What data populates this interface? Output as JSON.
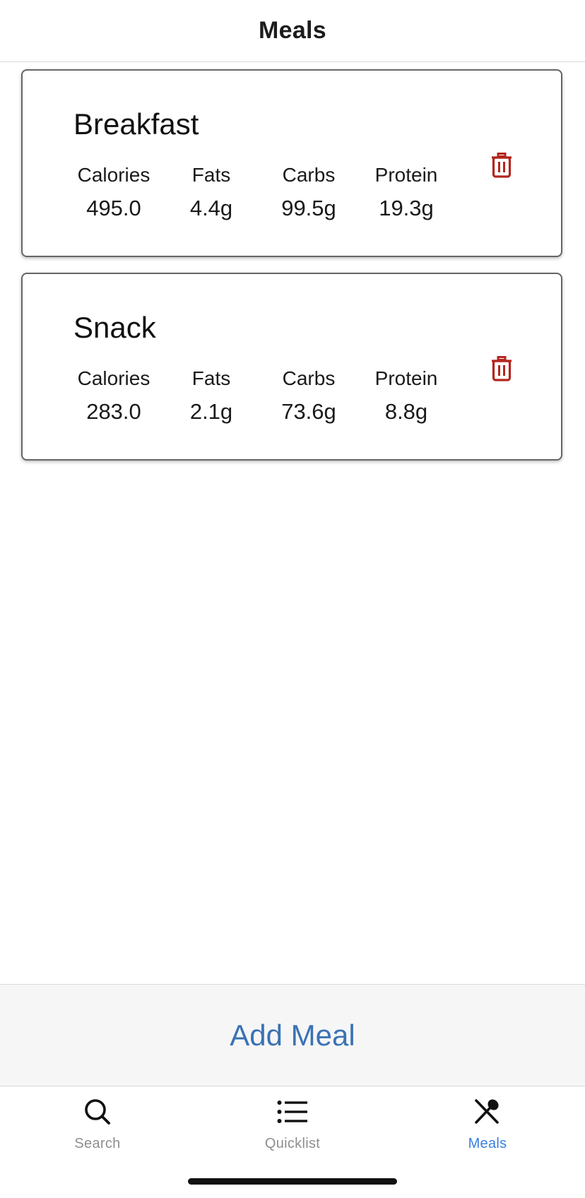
{
  "header": {
    "title": "Meals"
  },
  "stat_labels": {
    "calories": "Calories",
    "fats": "Fats",
    "carbs": "Carbs",
    "protein": "Protein"
  },
  "meals": [
    {
      "name": "Breakfast",
      "calories": "495.0",
      "fats": "4.4g",
      "carbs": "99.5g",
      "protein": "19.3g",
      "delete_icon": "trash-icon"
    },
    {
      "name": "Snack",
      "calories": "283.0",
      "fats": "2.1g",
      "carbs": "73.6g",
      "protein": "8.8g",
      "delete_icon": "trash-icon"
    }
  ],
  "add_meal": {
    "label": "Add Meal"
  },
  "tabs": [
    {
      "label": "Search",
      "icon": "search-icon",
      "active": false
    },
    {
      "label": "Quicklist",
      "icon": "list-icon",
      "active": false
    },
    {
      "label": "Meals",
      "icon": "utensils-icon",
      "active": true
    }
  ],
  "colors": {
    "accent": "#3a7fe0",
    "add_meal_text": "#3a72b5",
    "delete_red": "#b3261e",
    "inactive_tab": "#8e8e8e"
  }
}
